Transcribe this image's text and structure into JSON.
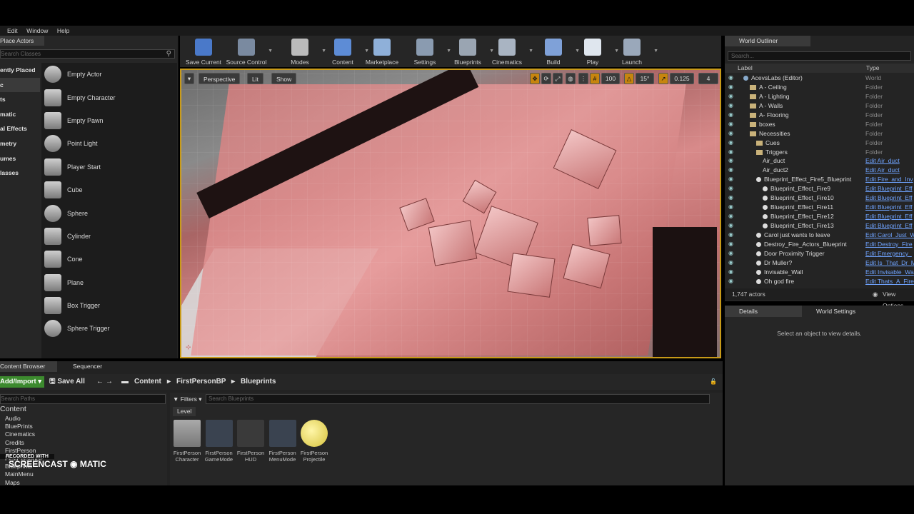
{
  "menubar": [
    "Edit",
    "Window",
    "Help"
  ],
  "place_actors": {
    "tab": "Place Actors",
    "search_placeholder": "Search Classes",
    "categories": [
      "Recently Placed",
      "Basic",
      "Lights",
      "Cinematic",
      "Visual Effects",
      "Geometry",
      "Volumes",
      "All Classes"
    ],
    "categories_shown": [
      "ently Placed",
      "c",
      "ts",
      "matic",
      "al Effects",
      "metry",
      "umes",
      "lasses"
    ],
    "items": [
      "Empty Actor",
      "Empty Character",
      "Empty Pawn",
      "Point Light",
      "Player Start",
      "Cube",
      "Sphere",
      "Cylinder",
      "Cone",
      "Plane",
      "Box Trigger",
      "Sphere Trigger"
    ]
  },
  "toolbar": [
    "Save Current",
    "Source Control",
    "Modes",
    "Content",
    "Marketplace",
    "Settings",
    "Blueprints",
    "Cinematics",
    "Build",
    "Play",
    "Launch"
  ],
  "viewport": {
    "perspective": "Perspective",
    "lit": "Lit",
    "show": "Show",
    "grid_snap": "100",
    "rot_snap": "15°",
    "scale_snap": "0.125",
    "cam_speed": "4"
  },
  "outliner": {
    "tab": "World Outliner",
    "search_placeholder": "Search...",
    "col_label": "Label",
    "col_type": "Type",
    "rows": [
      {
        "name": "AcevsLabs (Editor)",
        "type": "World",
        "indent": 0,
        "link": false,
        "icon": "world"
      },
      {
        "name": "A - Ceiling",
        "type": "Folder",
        "indent": 1,
        "link": false,
        "icon": "folder"
      },
      {
        "name": "A - Lighting",
        "type": "Folder",
        "indent": 1,
        "link": false,
        "icon": "folder"
      },
      {
        "name": "A - Walls",
        "type": "Folder",
        "indent": 1,
        "link": false,
        "icon": "folder"
      },
      {
        "name": "A- Flooring",
        "type": "Folder",
        "indent": 1,
        "link": false,
        "icon": "folder"
      },
      {
        "name": "boxes",
        "type": "Folder",
        "indent": 1,
        "link": false,
        "icon": "folder"
      },
      {
        "name": "Necessities",
        "type": "Folder",
        "indent": 1,
        "link": false,
        "icon": "folder"
      },
      {
        "name": "Cues",
        "type": "Folder",
        "indent": 2,
        "link": false,
        "icon": "folder"
      },
      {
        "name": "Triggers",
        "type": "Folder",
        "indent": 2,
        "link": false,
        "icon": "folder"
      },
      {
        "name": "Air_duct",
        "type": "Edit Air_duct",
        "indent": 3,
        "link": true,
        "icon": "none"
      },
      {
        "name": "Air_duct2",
        "type": "Edit Air_duct",
        "indent": 3,
        "link": true,
        "icon": "none"
      },
      {
        "name": "Blueprint_Effect_Fire5_Blueprint",
        "type": "Edit Fire_and_Inv",
        "indent": 2,
        "link": true,
        "icon": "dot"
      },
      {
        "name": "Blueprint_Effect_Fire9",
        "type": "Edit Blueprint_Eff",
        "indent": 3,
        "link": true,
        "icon": "dot"
      },
      {
        "name": "Blueprint_Effect_Fire10",
        "type": "Edit Blueprint_Eff",
        "indent": 3,
        "link": true,
        "icon": "dot"
      },
      {
        "name": "Blueprint_Effect_Fire11",
        "type": "Edit Blueprint_Eff",
        "indent": 3,
        "link": true,
        "icon": "dot"
      },
      {
        "name": "Blueprint_Effect_Fire12",
        "type": "Edit Blueprint_Eff",
        "indent": 3,
        "link": true,
        "icon": "dot"
      },
      {
        "name": "Blueprint_Effect_Fire13",
        "type": "Edit Blueprint_Eff",
        "indent": 3,
        "link": true,
        "icon": "dot"
      },
      {
        "name": "Carol just wants to leave",
        "type": "Edit Carol_Just_W",
        "indent": 2,
        "link": true,
        "icon": "dot"
      },
      {
        "name": "Destroy_Fire_Actors_Blueprint",
        "type": "Edit Destroy_Fire",
        "indent": 2,
        "link": true,
        "icon": "dot"
      },
      {
        "name": "Door Proximity Trigger",
        "type": "Edit Emergency_",
        "indent": 2,
        "link": true,
        "icon": "dot"
      },
      {
        "name": "Dr Muller?",
        "type": "Edit Is_That_Dr_M",
        "indent": 2,
        "link": true,
        "icon": "dot"
      },
      {
        "name": "Invisable_Wall",
        "type": "Edit Invisable_Wa",
        "indent": 2,
        "link": true,
        "icon": "dot"
      },
      {
        "name": "Oh god fire",
        "type": "Edit Thats_A_Fire",
        "indent": 2,
        "link": true,
        "icon": "dot"
      }
    ],
    "actor_count": "1,747 actors",
    "view_options": "View Options"
  },
  "details": {
    "tab1": "Details",
    "tab2": "World Settings",
    "empty_msg": "Select an object to view details."
  },
  "content_browser": {
    "tab1": "Content Browser",
    "tab2": "Sequencer",
    "add_import": "Add/Import",
    "save_all": "Save All",
    "crumbs": [
      "Content",
      "FirstPersonBP",
      "Blueprints"
    ],
    "search_paths": "Search Paths",
    "filters": "Filters",
    "search_assets": "Search Blueprints",
    "level_chip": "Level",
    "tree": [
      "Content",
      "Audio",
      "BluePrints",
      "Cinematics",
      "Credits",
      "FirstPerson",
      "FirstPersonBP",
      "Blueprints",
      "MainMenu",
      "Maps"
    ],
    "assets": [
      {
        "name": "FirstPerson\nCharacter",
        "kind": "character"
      },
      {
        "name": "FirstPerson\nGameMode",
        "kind": "gamepad"
      },
      {
        "name": "FirstPerson\nHUD",
        "kind": "hud"
      },
      {
        "name": "FirstPerson\nMenuMode",
        "kind": "gamepad"
      },
      {
        "name": "FirstPerson\nProjectile",
        "kind": "sphere"
      }
    ]
  },
  "watermark": {
    "line1": "RECORDED WITH",
    "line2": "SCREENCAST",
    "line3": "MATIC"
  }
}
